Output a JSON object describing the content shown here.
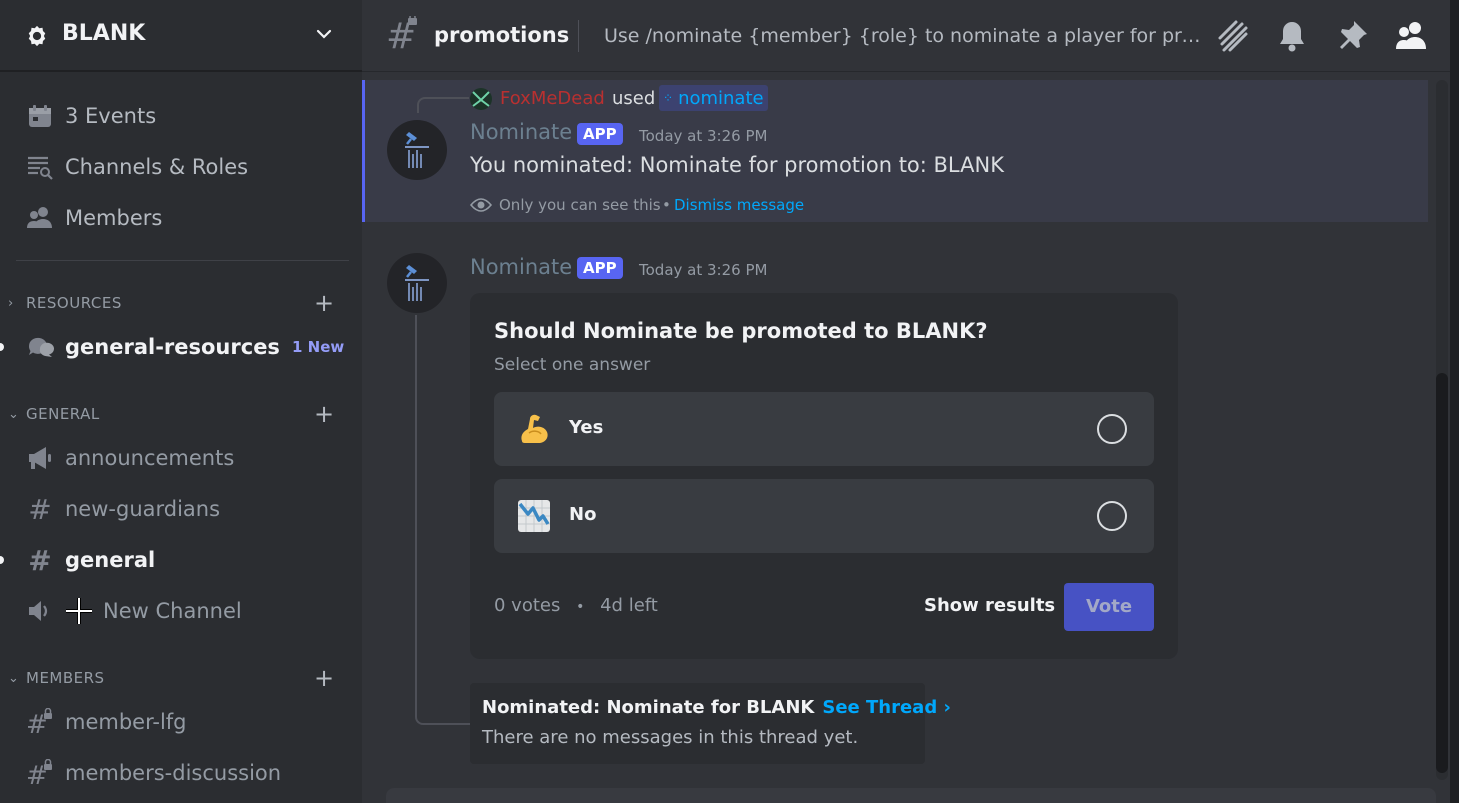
{
  "server": {
    "name": "BLANK"
  },
  "sidebar": {
    "top_items": [
      {
        "label": "3 Events",
        "icon": "calendar-icon"
      },
      {
        "label": "Channels & Roles",
        "icon": "channels-roles-icon"
      },
      {
        "label": "Members",
        "icon": "members-icon"
      }
    ],
    "categories": [
      {
        "name": "RESOURCES",
        "channels": [
          {
            "name": "general-resources",
            "type": "forum",
            "unread": true,
            "badge": "1 New"
          }
        ]
      },
      {
        "name": "GENERAL",
        "channels": [
          {
            "name": "announcements",
            "type": "announcement"
          },
          {
            "name": "new-guardians",
            "type": "text"
          },
          {
            "name": "general",
            "type": "text",
            "unread": true
          },
          {
            "name": "New Channel",
            "type": "voice"
          }
        ]
      },
      {
        "name": "MEMBERS",
        "channels": [
          {
            "name": "member-lfg",
            "type": "locked-text"
          },
          {
            "name": "members-discussion",
            "type": "locked-text"
          }
        ]
      }
    ]
  },
  "header": {
    "channel_name": "promotions",
    "topic": "Use /nominate {member} {role} to nominate a player for promotion"
  },
  "messages": {
    "ephemeral": {
      "reply_user": "FoxMeDead",
      "reply_used": "used",
      "reply_command": "nominate",
      "author": "Nominate",
      "badge": "APP",
      "timestamp": "Today at 3:26 PM",
      "text": "You nominated: Nominate for promotion to: BLANK",
      "only_you": "Only you can see this",
      "bullet": "•",
      "dismiss": "Dismiss message"
    },
    "poll_message": {
      "author": "Nominate",
      "badge": "APP",
      "timestamp": "Today at 3:26 PM",
      "poll": {
        "question": "Should Nominate be promoted to BLANK?",
        "subtitle": "Select one answer",
        "options": [
          {
            "label": "Yes",
            "emoji": "flexed-biceps"
          },
          {
            "label": "No",
            "emoji": "chart-decreasing"
          }
        ],
        "votes": "0 votes",
        "separator": "•",
        "time_left": "4d left",
        "show_results": "Show results",
        "vote": "Vote"
      },
      "thread": {
        "title": "Nominated: Nominate for BLANK",
        "link": "See Thread ›",
        "empty": "There are no messages in this thread yet."
      }
    }
  },
  "colors": {
    "accent": "#5865f2",
    "link": "#00a8fc",
    "reply_user": "#b93030"
  }
}
